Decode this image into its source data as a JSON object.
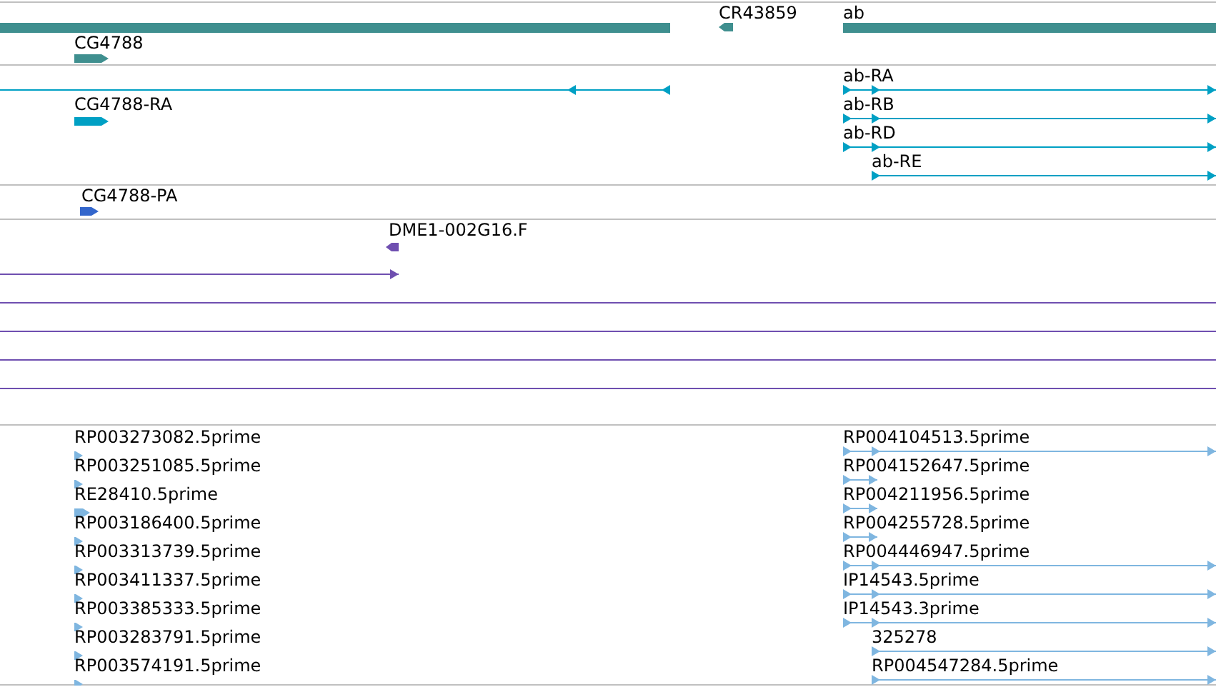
{
  "tracks": [
    {
      "color": "#3f8f8f",
      "features": [
        {
          "kind": "bar"
        },
        {
          "kind": "block",
          "reverse": false,
          "label": "CG4788"
        },
        {
          "kind": "block",
          "reverse": true,
          "label": "CR43859"
        },
        {
          "kind": "bar",
          "label": "ab"
        }
      ]
    },
    {
      "color": "#00a0c4",
      "features": [
        {
          "kind": "line",
          "reverse": true
        },
        {
          "kind": "block",
          "reverse": false,
          "label": "CG4788-RA"
        },
        {
          "kind": "line",
          "reverse": false,
          "label": "ab-RA"
        },
        {
          "kind": "line",
          "reverse": false,
          "label": "ab-RB"
        },
        {
          "kind": "line",
          "reverse": false,
          "label": "ab-RD"
        },
        {
          "kind": "line",
          "reverse": false,
          "label": "ab-RE"
        }
      ]
    },
    {
      "color": "#3366cc",
      "features": [
        {
          "kind": "block",
          "reverse": false,
          "label": "CG4788-PA"
        }
      ]
    },
    {
      "color": "#6f4fb0",
      "features": [
        {
          "kind": "block",
          "reverse": true,
          "label": "DME1-002G16.F"
        },
        {
          "kind": "line",
          "reverse": false
        },
        {
          "kind": "line"
        },
        {
          "kind": "line"
        },
        {
          "kind": "line"
        },
        {
          "kind": "line"
        }
      ]
    },
    {
      "color": "#7fb6e0",
      "features": [
        {
          "kind": "block",
          "reverse": false,
          "label": "RP003273082.5prime"
        },
        {
          "kind": "block",
          "reverse": false,
          "label": "RP003251085.5prime"
        },
        {
          "kind": "block",
          "reverse": false,
          "label": "RE28410.5prime"
        },
        {
          "kind": "block",
          "reverse": false,
          "label": "RP003186400.5prime"
        },
        {
          "kind": "block",
          "reverse": false,
          "label": "RP003313739.5prime"
        },
        {
          "kind": "block",
          "reverse": false,
          "label": "RP003411337.5prime"
        },
        {
          "kind": "block",
          "reverse": false,
          "label": "RP003385333.5prime"
        },
        {
          "kind": "block",
          "reverse": false,
          "label": "RP003283791.5prime"
        },
        {
          "kind": "block",
          "reverse": false,
          "label": "RP003574191.5prime"
        },
        {
          "kind": "line",
          "reverse": false,
          "label": "RP004104513.5prime"
        },
        {
          "kind": "line",
          "reverse": false,
          "label": "RP004152647.5prime"
        },
        {
          "kind": "line",
          "reverse": false,
          "label": "RP004211956.5prime"
        },
        {
          "kind": "line",
          "reverse": false,
          "label": "RP004255728.5prime"
        },
        {
          "kind": "line",
          "reverse": false,
          "label": "RP004446947.5prime"
        },
        {
          "kind": "line",
          "reverse": false,
          "label": "IP14543.5prime"
        },
        {
          "kind": "line",
          "reverse": false,
          "label": "IP14543.3prime"
        },
        {
          "kind": "line",
          "reverse": false,
          "label": "325278"
        },
        {
          "kind": "line",
          "reverse": false,
          "label": "RP004547284.5prime"
        }
      ]
    }
  ]
}
